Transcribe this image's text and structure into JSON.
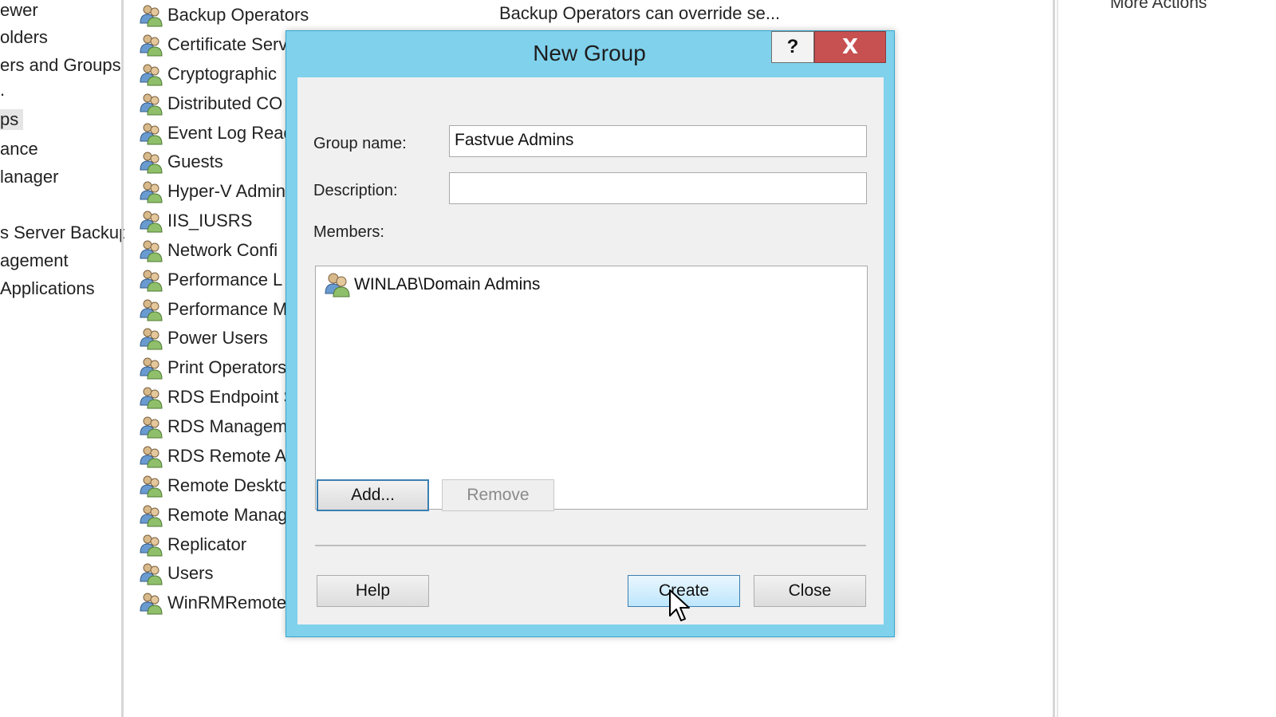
{
  "left_tree": {
    "items": [
      {
        "label": "ewer"
      },
      {
        "label": "olders"
      },
      {
        "label": "ers and Groups"
      },
      {
        "label": "."
      },
      {
        "label": "ps",
        "selected": true
      },
      {
        "label": "ance"
      },
      {
        "label": "lanager"
      },
      {
        "label": "s Server Backup"
      },
      {
        "label": "agement"
      },
      {
        "label": " Applications"
      }
    ]
  },
  "groups": {
    "icon": "group-icon",
    "first_description": "Backup Operators can override se...",
    "rows": [
      "Backup Operators",
      "Certificate Serv",
      "Cryptographic",
      "Distributed CO",
      "Event Log Read",
      "Guests",
      "Hyper-V Admin",
      "IIS_IUSRS",
      "Network Confi",
      "Performance L",
      "Performance M",
      "Power Users",
      "Print Operators",
      "RDS Endpoint S",
      "RDS Managem",
      "RDS Remote A",
      "Remote Deskto",
      "Remote Manag",
      "Replicator",
      "Users",
      "WinRMRemote"
    ]
  },
  "actions": {
    "more_actions": "More Actions"
  },
  "dialog": {
    "title": "New Group",
    "help_glyph": "?",
    "close_glyph": "x",
    "group_name_label": "Group name:",
    "group_name_value": "Fastvue Admins",
    "description_label": "Description:",
    "description_value": "",
    "members_label": "Members:",
    "members": [
      "WINLAB\\Domain Admins"
    ],
    "add_button": "Add...",
    "remove_button": "Remove",
    "help_button": "Help",
    "create_button": "Create",
    "close_button": "Close"
  },
  "colors": {
    "dialog_frame": "#7fd1ec",
    "close_button": "#c75050",
    "dialog_body": "#f0f0f0"
  }
}
